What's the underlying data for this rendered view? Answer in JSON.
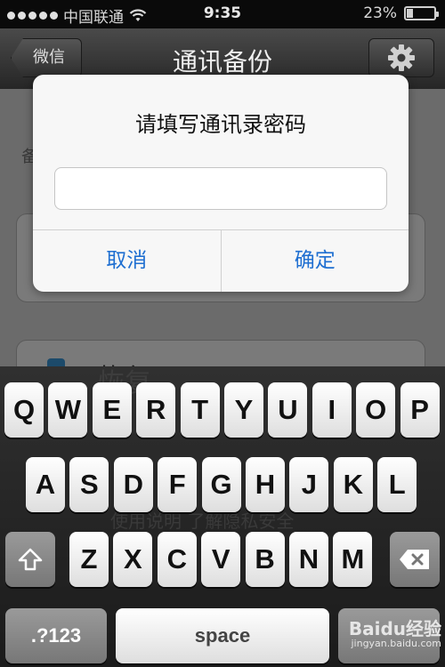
{
  "status_bar": {
    "carrier": "中国联通",
    "time": "9:35",
    "battery": "23%",
    "battery_level": 0.23
  },
  "nav": {
    "back_label": "微信",
    "title": "通讯备份",
    "settings_icon": "gear-icon"
  },
  "content": {
    "side_label": "备",
    "restore_label": "恢复",
    "footer_links": "使用说明  了解隐私安全"
  },
  "dialog": {
    "title": "请填写通讯录密码",
    "input_value": "",
    "cancel_label": "取消",
    "confirm_label": "确定"
  },
  "keyboard": {
    "row1": [
      "Q",
      "W",
      "E",
      "R",
      "T",
      "Y",
      "U",
      "I",
      "O",
      "P"
    ],
    "row2": [
      "A",
      "S",
      "D",
      "F",
      "G",
      "H",
      "J",
      "K",
      "L"
    ],
    "row3": [
      "Z",
      "X",
      "C",
      "V",
      "B",
      "N",
      "M"
    ],
    "numbers_label": ".?123",
    "space_label": "space",
    "shift_icon": "shift-icon",
    "delete_icon": "backspace-icon"
  },
  "watermark": {
    "brand": "Baidu经验",
    "site": "jingyan.baidu.com"
  },
  "colors": {
    "accent": "#1f6fd1",
    "navbar": "#3a3a3a",
    "dim": "#6b6b6b"
  }
}
